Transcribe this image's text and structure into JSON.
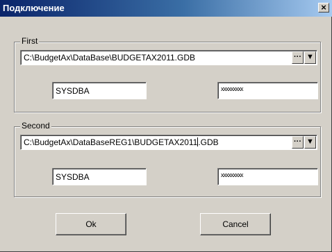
{
  "window": {
    "title": "Подключение",
    "close_label": "×"
  },
  "first": {
    "group_label": "First",
    "path": "C:\\BudgetAx\\DataBase\\BUDGETAX2011.GDB",
    "user": "SYSDBA",
    "password_mask": "xxxxxxxxx"
  },
  "second": {
    "group_label": "Second",
    "path_before_caret": "C:\\BudgetAx\\DataBaseREG1\\BUDGETAX2011",
    "path_after_caret": ".GDB",
    "user": "SYSDBA",
    "password_mask": "xxxxxxxxx"
  },
  "combo": {
    "browse_label": "···",
    "dropdown_label": "▼"
  },
  "buttons": {
    "ok": "Ok",
    "cancel": "Cancel"
  }
}
